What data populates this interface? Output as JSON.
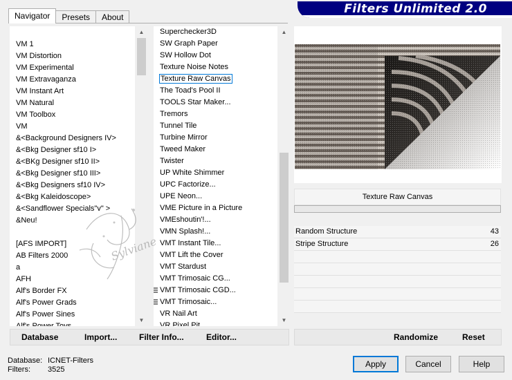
{
  "banner": {
    "title": "Filters Unlimited 2.0"
  },
  "tabs": [
    {
      "label": "Navigator",
      "active": true
    },
    {
      "label": "Presets",
      "active": false
    },
    {
      "label": "About",
      "active": false
    }
  ],
  "categories": [
    "VM 1",
    "VM Distortion",
    "VM Experimental",
    "VM Extravaganza",
    "VM Instant Art",
    "VM Natural",
    "VM Toolbox",
    "VM",
    "&<Background Designers IV>",
    "&<Bkg Designer sf10 I>",
    "&<BKg Designer sf10 II>",
    "&<Bkg Designer sf10 III>",
    "&<Bkg Designers sf10 IV>",
    "&<Bkg Kaleidoscope>",
    "&<Sandflower Specials\"v\" >",
    "&Neu!",
    "",
    "[AFS IMPORT]",
    "AB Filters 2000",
    "a",
    "AFH",
    "Alf's Border FX",
    "Alf's Power Grads",
    "Alf's Power Sines",
    "Alf's Power Toys"
  ],
  "filters": [
    {
      "label": "Superchecker3D",
      "grid": false
    },
    {
      "label": "SW Graph Paper",
      "grid": false
    },
    {
      "label": "SW Hollow Dot",
      "grid": false
    },
    {
      "label": "Texture Noise Notes",
      "grid": false
    },
    {
      "label": "Texture Raw Canvas",
      "grid": false,
      "selected": true
    },
    {
      "label": "The Toad's Pool II",
      "grid": false
    },
    {
      "label": "TOOLS Star Maker...",
      "grid": false
    },
    {
      "label": "Tremors",
      "grid": false
    },
    {
      "label": "Tunnel Tile",
      "grid": false
    },
    {
      "label": "Turbine Mirror",
      "grid": false
    },
    {
      "label": "Tweed Maker",
      "grid": false
    },
    {
      "label": "Twister",
      "grid": false
    },
    {
      "label": "UP White Shimmer",
      "grid": false
    },
    {
      "label": "UPC Factorize...",
      "grid": false
    },
    {
      "label": "UPE Neon...",
      "grid": false
    },
    {
      "label": "VME Picture in a Picture",
      "grid": false
    },
    {
      "label": "VMEshoutin'!...",
      "grid": false
    },
    {
      "label": "VMN Splash!...",
      "grid": false
    },
    {
      "label": "VMT Instant Tile...",
      "grid": false
    },
    {
      "label": "VMT Lift the Cover",
      "grid": false
    },
    {
      "label": "VMT Stardust",
      "grid": false
    },
    {
      "label": "VMT Trimosaic CG...",
      "grid": false
    },
    {
      "label": "VMT Trimosaic CGD...",
      "grid": true
    },
    {
      "label": "VMT Trimosaic...",
      "grid": true
    },
    {
      "label": "VR Nail Art",
      "grid": false
    },
    {
      "label": "VR Pixel Pit",
      "grid": false
    }
  ],
  "preview": {
    "filter_name": "Texture Raw Canvas"
  },
  "params": [
    {
      "name": "Random Structure",
      "value": "43"
    },
    {
      "name": "Stripe Structure",
      "value": "26"
    }
  ],
  "toolbar_left": {
    "database": "Database",
    "import": "Import...",
    "filter_info": "Filter Info...",
    "editor": "Editor..."
  },
  "toolbar_right": {
    "randomize": "Randomize",
    "reset": "Reset"
  },
  "status": {
    "database_label": "Database:",
    "database_value": "ICNET-Filters",
    "filters_label": "Filters:",
    "filters_value": "3525"
  },
  "buttons": {
    "apply": "Apply",
    "cancel": "Cancel",
    "help": "Help"
  },
  "watermark_text": "Sylviane",
  "colors": {
    "banner": "#000080",
    "selection_border": "#0078d7"
  }
}
